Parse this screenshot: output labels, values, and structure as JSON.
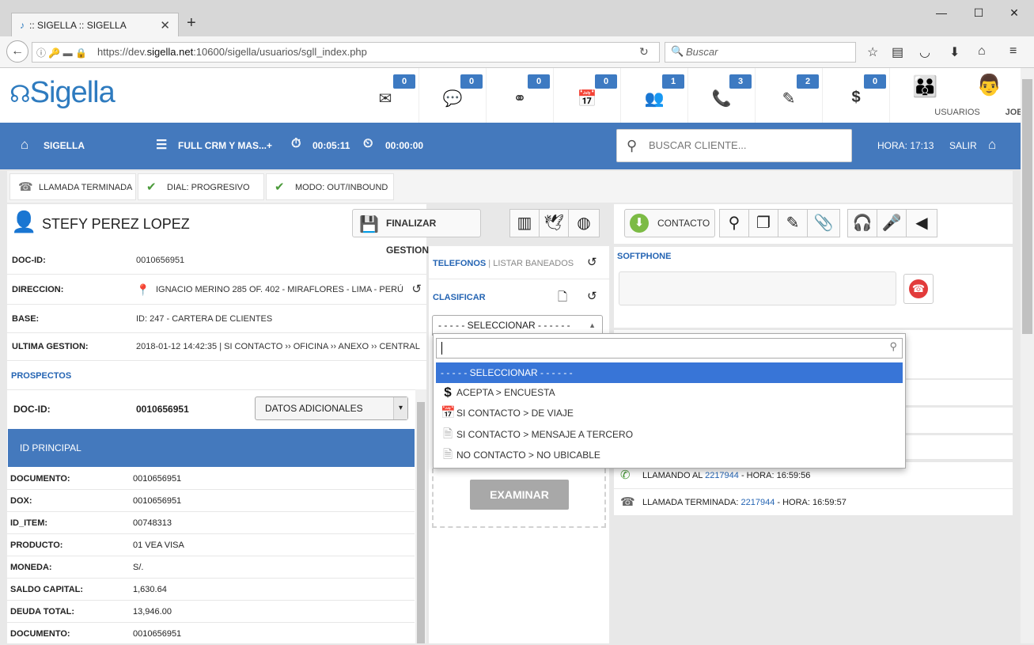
{
  "browser": {
    "tab_title": ":: SIGELLA :: SIGELLA",
    "url_prefix": "https://dev.",
    "url_domain": "sigella.net",
    "url_rest": ":10600/sigella/usuarios/sgll_index.php",
    "search_placeholder": "Buscar"
  },
  "app": {
    "logo": "Sigella",
    "header_icons": [
      {
        "name": "email",
        "badge": "0"
      },
      {
        "name": "sms",
        "badge": "0"
      },
      {
        "name": "voicemail",
        "badge": "0"
      },
      {
        "name": "calendar",
        "badge": "0"
      },
      {
        "name": "contacts",
        "badge": "1"
      },
      {
        "name": "calls",
        "badge": "3"
      },
      {
        "name": "notes",
        "badge": "2"
      },
      {
        "name": "dollar",
        "badge": "0"
      }
    ],
    "usuarios_label": "USUARIOS",
    "user_label": "JOEL"
  },
  "bluebar": {
    "home_label": "SIGELLA",
    "campaign_label": "FULL CRM Y MAS...+",
    "timer1": "00:05:11",
    "timer2": "00:00:00",
    "search_placeholder": "BUSCAR CLIENTE...",
    "hora": "HORA: 17:13",
    "salir": "SALIR"
  },
  "status": {
    "call": "LLAMADA TERMINADA",
    "dial": "DIAL: PROGRESIVO",
    "mode": "MODO: OUT/INBOUND"
  },
  "client": {
    "name": "STEFY PEREZ LOPEZ",
    "finalize_label": "FINALIZAR GESTION",
    "fields": [
      {
        "k": "DOC-ID:",
        "v": "0010656951"
      },
      {
        "k": "DIRECCION:",
        "v": "IGNACIO MERINO 285 OF. 402 - MIRAFLORES - LIMA - PERÚ"
      },
      {
        "k": "BASE:",
        "v": "ID: 247 - CARTERA DE CLIENTES"
      },
      {
        "k": "ULTIMA GESTION:",
        "v": "2018-01-12 14:42:35 | SI CONTACTO ›› OFICINA ›› ANEXO ›› CENTRAL"
      }
    ],
    "prospectos_label": "PROSPECTOS",
    "prospect_doc_key": "DOC-ID:",
    "prospect_doc_val": "0010656951",
    "datos_select": "DATOS ADICIONALES",
    "id_principal": "ID PRINCIPAL",
    "details": [
      {
        "k": "DOCUMENTO:",
        "v": "0010656951"
      },
      {
        "k": "DOX:",
        "v": "0010656951"
      },
      {
        "k": "ID_ITEM:",
        "v": "00748313"
      },
      {
        "k": "PRODUCTO:",
        "v": "01 VEA VISA"
      },
      {
        "k": "MONEDA:",
        "v": "S/."
      },
      {
        "k": "SALDO CAPITAL:",
        "v": "1,630.64"
      },
      {
        "k": "DEUDA TOTAL:",
        "v": "13,946.00"
      },
      {
        "k": "DOCUMENTO:",
        "v": "0010656951"
      }
    ]
  },
  "middle": {
    "telefonos": "TELEFONOS",
    "listar": "LISTAR BANEADOS",
    "clasificar": "CLASIFICAR",
    "select_value": "- - - - - SELECCIONAR - - - - - -",
    "examinar": "EXAMINAR"
  },
  "dropdown": {
    "options": [
      {
        "label": "- - - - - SELECCIONAR - - - - - -",
        "icon": ""
      },
      {
        "label": "ACEPTA > ENCUESTA",
        "icon": "$"
      },
      {
        "label": "SI CONTACTO > DE VIAJE",
        "icon": "📅"
      },
      {
        "label": "SI CONTACTO > MENSAJE A TERCERO",
        "icon": "🗎"
      },
      {
        "label": "NO CONTACTO > NO UBICABLE",
        "icon": "🗎"
      }
    ]
  },
  "right": {
    "contacto_label": "CONTACTO",
    "softphone_label": "SOFTPHONE",
    "log": [
      {
        "pre": "LLAMANDO AL ",
        "num": "2217944",
        "post": " - HORA: 16:59:56"
      },
      {
        "pre": "LLAMADA TERMINADA: ",
        "num": "2217944",
        "post": " - HORA: 16:59:57"
      }
    ]
  }
}
